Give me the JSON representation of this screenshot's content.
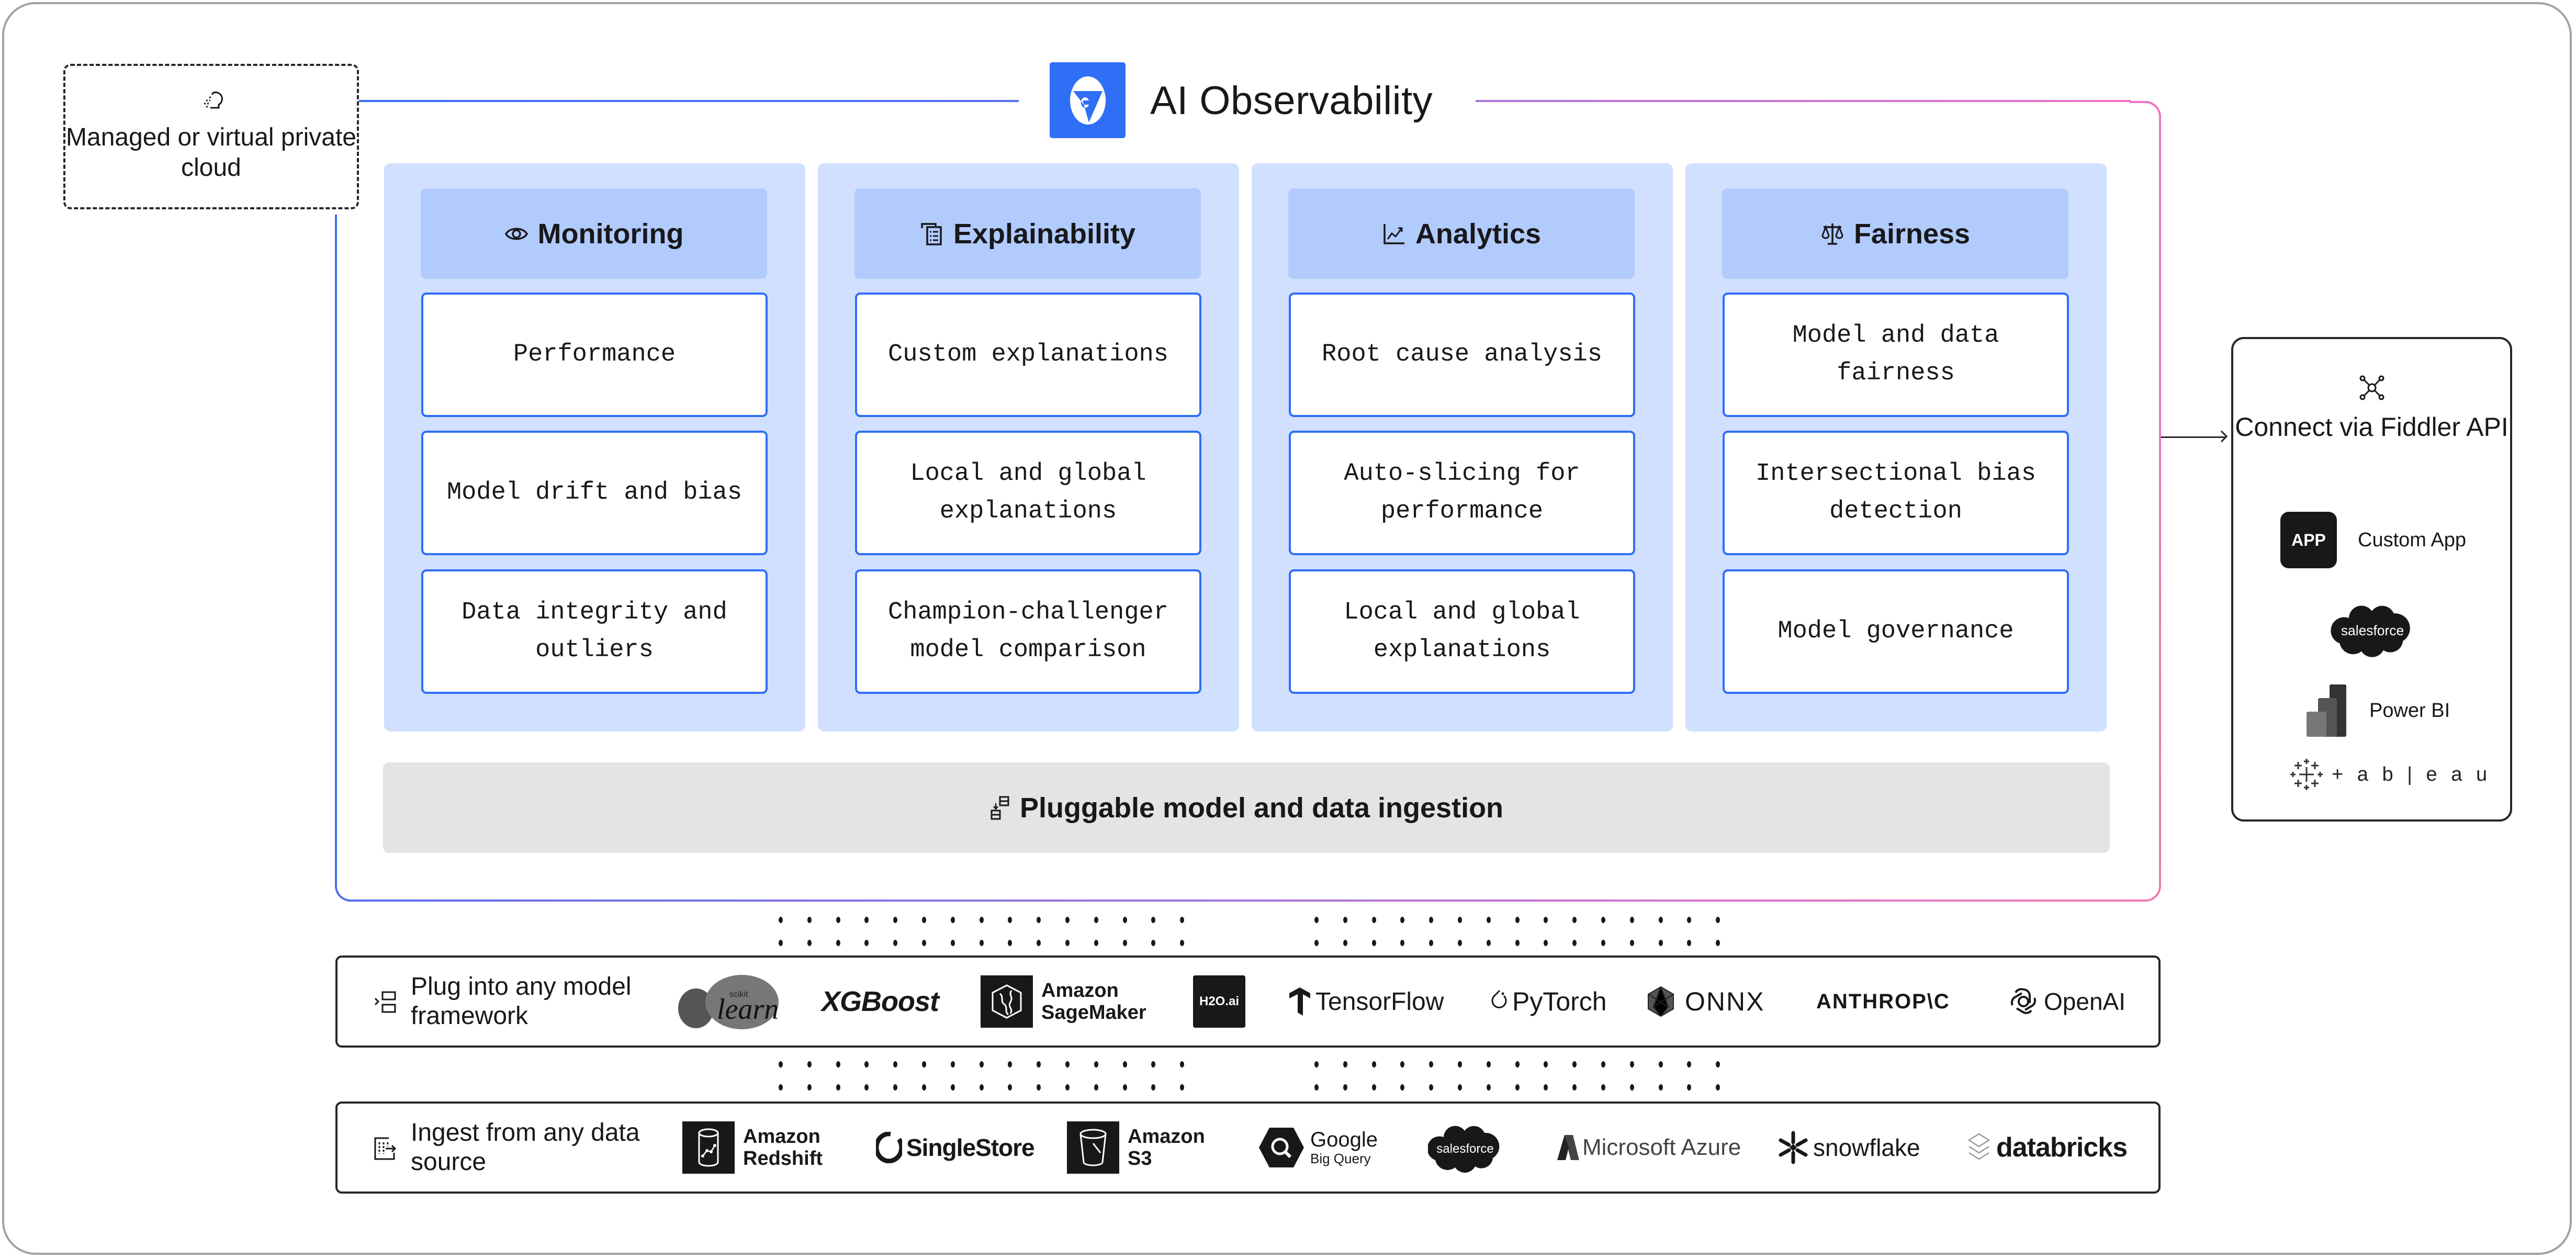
{
  "cloud": {
    "icon": "cloud-icon",
    "label": "Managed or virtual private cloud"
  },
  "header": {
    "logo": "fiddler-logo-icon",
    "title": "AI Observability"
  },
  "colors": {
    "accent": "#2f6ff6",
    "column_bg": "#d1e0fe",
    "header_bg": "#b2cbfd",
    "ingestion_bg": "#e4e4e7",
    "gradient_end": "#f072c8"
  },
  "columns": [
    {
      "title": "Monitoring",
      "icon": "eye-icon",
      "items": [
        "Performance",
        "Model drift and bias",
        "Data integrity and outliers"
      ]
    },
    {
      "title": "Explainability",
      "icon": "document-list-icon",
      "items": [
        "Custom explanations",
        "Local and global explanations",
        "Champion-challenger model comparison"
      ]
    },
    {
      "title": "Analytics",
      "icon": "line-chart-icon",
      "items": [
        "Root cause analysis",
        "Auto-slicing for performance",
        "Local and global explanations"
      ]
    },
    {
      "title": "Fairness",
      "icon": "scale-icon",
      "items": [
        "Model and data fairness",
        "Intersectional bias detection",
        "Model governance"
      ]
    }
  ],
  "ingestion": {
    "icon": "data-transfer-icon",
    "label": "Pluggable model and data ingestion"
  },
  "frameworks": {
    "icon": "plug-icon",
    "label": "Plug into any model framework",
    "logos": [
      {
        "name": "scikit-learn",
        "top": "scikit",
        "text": "learn"
      },
      {
        "name": "XGBoost",
        "text": "XGBoost"
      },
      {
        "name": "Amazon SageMaker",
        "text1": "Amazon",
        "text2": "SageMaker"
      },
      {
        "name": "H2O.ai",
        "text": "H2O.ai"
      },
      {
        "name": "TensorFlow",
        "text": "TensorFlow"
      },
      {
        "name": "PyTorch",
        "text": "PyTorch"
      },
      {
        "name": "ONNX",
        "text": "ONNX"
      },
      {
        "name": "Anthropic",
        "text": "ANTHROP\\C"
      },
      {
        "name": "OpenAI",
        "text": "OpenAI"
      }
    ]
  },
  "sources": {
    "icon": "ingest-icon",
    "label": "Ingest from any data source",
    "logos": [
      {
        "name": "Amazon Redshift",
        "text1": "Amazon",
        "text2": "Redshift"
      },
      {
        "name": "SingleStore",
        "text": "SingleStore"
      },
      {
        "name": "Amazon S3",
        "text1": "Amazon",
        "text2": "S3"
      },
      {
        "name": "Google BigQuery",
        "text1": "Google",
        "text2": "Big Query"
      },
      {
        "name": "Salesforce",
        "text": "salesforce"
      },
      {
        "name": "Microsoft Azure",
        "text": "Microsoft Azure"
      },
      {
        "name": "Snowflake",
        "text": "snowflake"
      },
      {
        "name": "Databricks",
        "text": "databricks"
      }
    ]
  },
  "api": {
    "icon": "network-hub-icon",
    "title": "Connect via Fiddler API",
    "items": [
      {
        "name": "Custom App",
        "badge": "APP",
        "label": "Custom App"
      },
      {
        "name": "Salesforce",
        "text": "salesforce"
      },
      {
        "name": "Power BI",
        "label": "Power BI"
      },
      {
        "name": "Tableau",
        "text": "+ a b | e a u"
      }
    ]
  }
}
